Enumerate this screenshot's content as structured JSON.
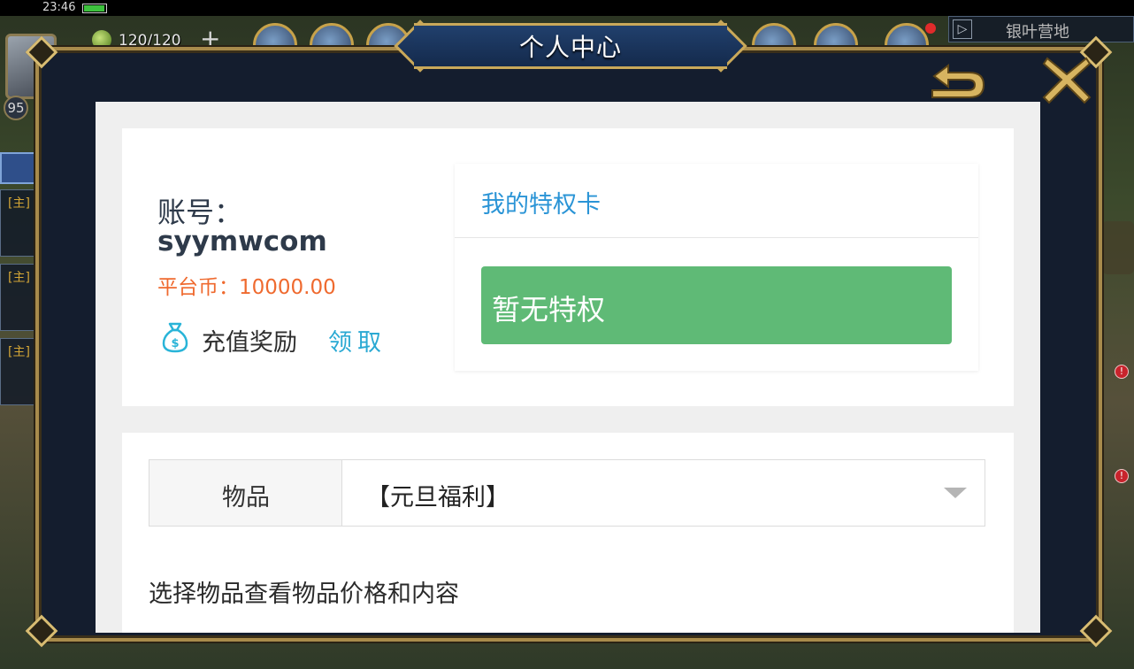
{
  "status_bar": {
    "time": "23:46"
  },
  "hud": {
    "stamina": "120/120",
    "level": "95",
    "map_name": "银叶营地"
  },
  "quests": [
    {
      "tag": "[主]"
    },
    {
      "tag": "[主]"
    },
    {
      "tag": "[主]"
    }
  ],
  "modal": {
    "title": "个人中心"
  },
  "account": {
    "label": "账号：",
    "username": "syymwcom",
    "platform_coin": "平台币：10000.00",
    "recharge_reward_label": "充值奖励",
    "claim_label": "领取"
  },
  "privilege": {
    "title": "我的特权卡",
    "status": "暂无特权"
  },
  "items": {
    "label": "物品",
    "selected": "【元旦福利】",
    "hint": "选择物品查看物品价格和内容"
  },
  "colors": {
    "accent_blue": "#2a94d6",
    "coin_orange": "#ef6a2f",
    "privilege_green": "#5fba76",
    "claim_cyan": "#2aa9d3",
    "frame_gold": "#a88b4c"
  },
  "icons": [
    "battery-icon",
    "stamina-icon",
    "bag-icon",
    "back-icon",
    "close-icon",
    "chevron-down-icon"
  ]
}
